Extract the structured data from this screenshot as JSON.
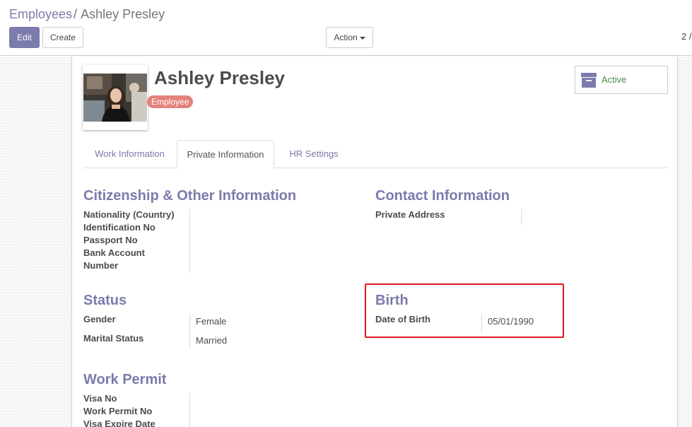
{
  "breadcrumb": {
    "parent": "Employees",
    "separator": "/",
    "current": "Ashley Presley"
  },
  "toolbar": {
    "edit_label": "Edit",
    "create_label": "Create",
    "action_label": "Action"
  },
  "pager": {
    "text": "2 /"
  },
  "employee": {
    "name": "Ashley Presley",
    "tag": "Employee",
    "status_label": "Active"
  },
  "tabs": [
    {
      "label": "Work Information"
    },
    {
      "label": "Private Information"
    },
    {
      "label": "HR Settings"
    }
  ],
  "sections": {
    "citizenship": {
      "title": "Citizenship & Other Information",
      "labels": [
        "Nationality (Country)",
        "Identification No",
        "Passport No",
        "Bank Account",
        "Number"
      ]
    },
    "contact": {
      "title": "Contact Information",
      "private_address_label": "Private Address"
    },
    "status": {
      "title": "Status",
      "gender_label": "Gender",
      "gender_value": "Female",
      "marital_label": "Marital Status",
      "marital_value": "Married"
    },
    "birth": {
      "title": "Birth",
      "dob_label": "Date of Birth",
      "dob_value": "05/01/1990"
    },
    "work_permit": {
      "title": "Work Permit",
      "labels": [
        "Visa No",
        "Work Permit No",
        "Visa Expire Date"
      ]
    }
  },
  "colors": {
    "accent": "#7c7bad",
    "tag": "#e4827c",
    "active": "#4a8c46",
    "highlight": "#e0161c"
  }
}
